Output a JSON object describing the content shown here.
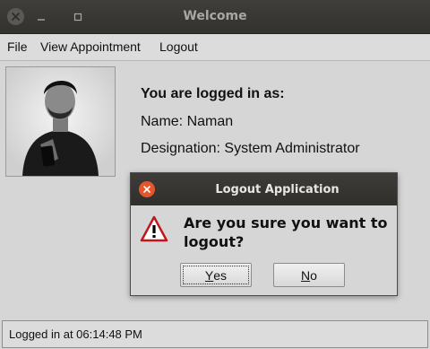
{
  "window": {
    "title": "Welcome",
    "controls": {
      "close_icon": "close-icon",
      "minimize_icon": "minimize-icon",
      "maximize_icon": "maximize-icon"
    }
  },
  "menubar": {
    "items": [
      "File",
      "View Appointment",
      "Logout"
    ]
  },
  "profile": {
    "photo_icon": "user-photo",
    "heading": "You are logged in as:",
    "name_line": "Name: Naman",
    "designation_line": "Designation: System Administrator"
  },
  "status": {
    "text": "Logged in at 06:14:48 PM"
  },
  "dialog": {
    "title": "Logout Application",
    "message": "Are you sure you want to logout?",
    "icon": "warning-icon",
    "yes": {
      "mnemonic": "Y",
      "rest": "es"
    },
    "no": {
      "mnemonic": "N",
      "rest": "o"
    }
  },
  "colors": {
    "titlebar_bg": "#33322f",
    "dialog_close": "#e5562c",
    "window_bg": "#d6d6d6"
  }
}
